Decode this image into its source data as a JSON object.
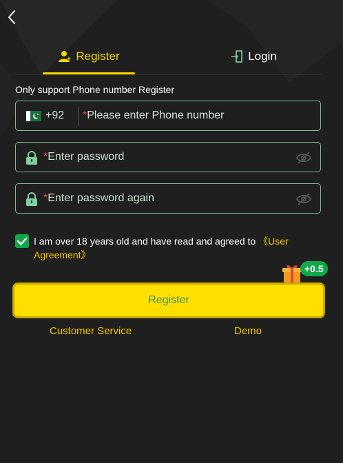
{
  "tabs": [
    {
      "label": "Register",
      "active": true,
      "icon": "user-add-icon"
    },
    {
      "label": "Login",
      "active": false,
      "icon": "login-door-icon"
    }
  ],
  "notice": "Only support Phone number Register",
  "phone": {
    "country_code": "+92",
    "flag": "pakistan-flag-icon",
    "required_mark": "*",
    "placeholder": "Please enter Phone number"
  },
  "password": {
    "required_mark": "*",
    "placeholder": "Enter password"
  },
  "password_again": {
    "required_mark": "*",
    "placeholder": "Enter password again"
  },
  "agreement": {
    "checked": true,
    "text": "I am over 18 years old and have read and agreed to ",
    "link": "《User Agreement》"
  },
  "bonus": "+0.5",
  "register_button": "Register",
  "footer": {
    "customer_service": "Customer Service",
    "demo": "Demo"
  },
  "colors": {
    "accent": "#f5d800",
    "field_border": "#7fb89a",
    "check_green": "#12a84a",
    "required": "#e8453c"
  }
}
